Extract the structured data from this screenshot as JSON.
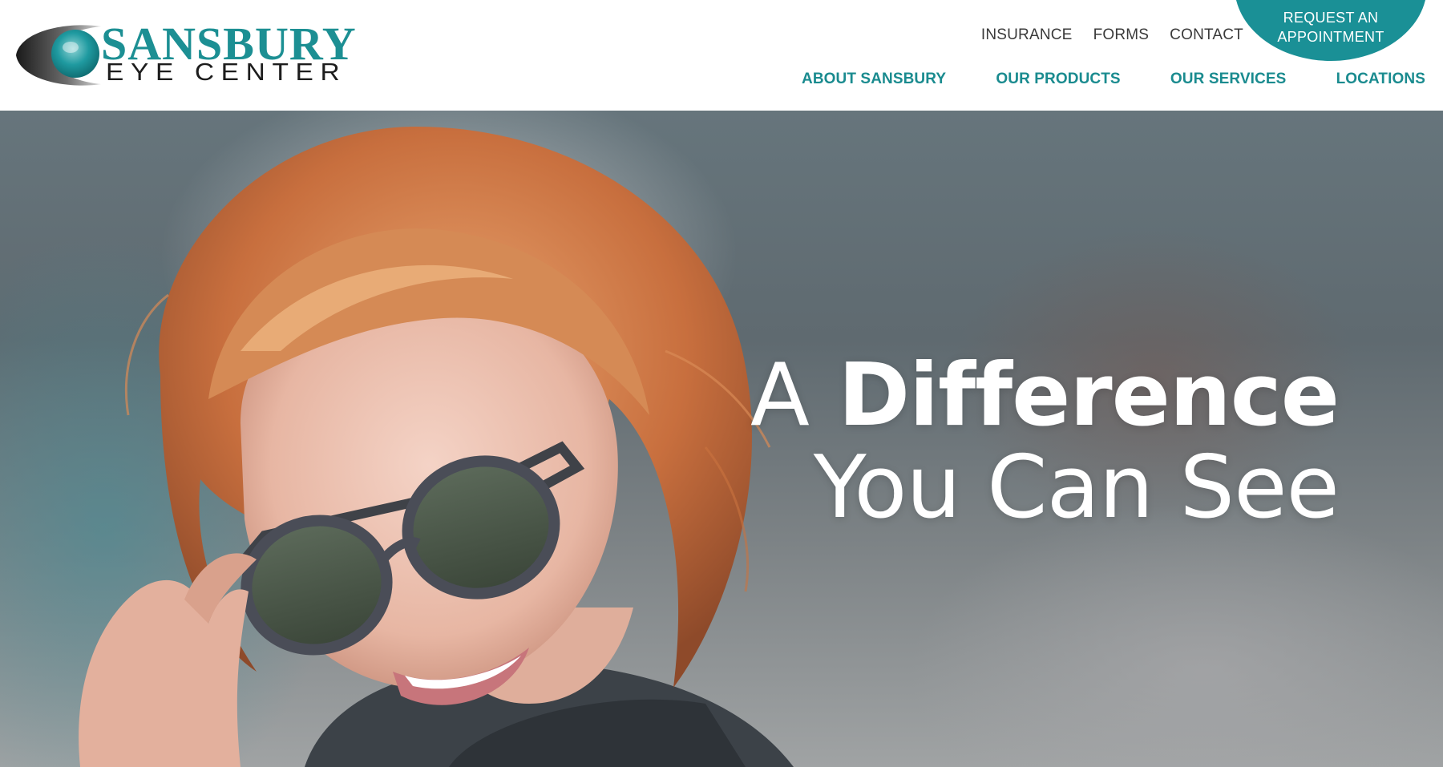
{
  "brand": {
    "name_top": "SANSBURY",
    "name_bottom": "EYE CENTER"
  },
  "utility_nav": [
    "INSURANCE",
    "FORMS",
    "CONTACT"
  ],
  "cta": {
    "line1": "REQUEST AN",
    "line2": "APPOINTMENT"
  },
  "main_nav": [
    "ABOUT SANSBURY",
    "OUR PRODUCTS",
    "OUR SERVICES",
    "LOCATIONS"
  ],
  "hero": {
    "headline_word_a": "A",
    "headline_word_b": "Difference",
    "headline_line2": "You Can See",
    "image": "woman-wearing-sunglasses-photo"
  },
  "colors": {
    "teal": "#1a9096",
    "nav_teal": "#1a8b8f",
    "text_dark": "#3a3a3a"
  }
}
